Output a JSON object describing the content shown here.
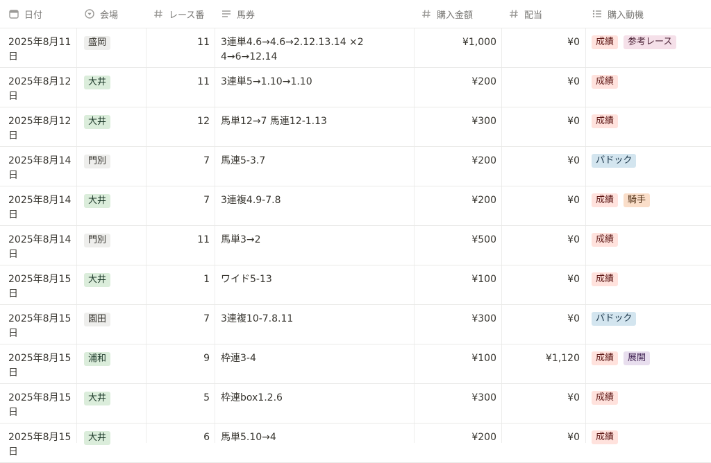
{
  "columns": [
    {
      "label": "日付",
      "icon": "calendar-icon"
    },
    {
      "label": "会場",
      "icon": "select-icon"
    },
    {
      "label": "レース番",
      "icon": "number-icon"
    },
    {
      "label": "馬券",
      "icon": "text-icon"
    },
    {
      "label": "購入金額",
      "icon": "number-icon"
    },
    {
      "label": "配当",
      "icon": "number-icon"
    },
    {
      "label": "購入動機",
      "icon": "list-icon"
    }
  ],
  "colors": {
    "venue": {
      "盛岡": {
        "bg": "#eeeeec",
        "fg": "#37352f"
      },
      "大井": {
        "bg": "#dbeddb",
        "fg": "#1c3829"
      },
      "門別": {
        "bg": "#eeeeec",
        "fg": "#37352f"
      },
      "園田": {
        "bg": "#eeeeec",
        "fg": "#37352f"
      },
      "浦和": {
        "bg": "#dbeddb",
        "fg": "#1c3829"
      }
    },
    "motive": {
      "成績": {
        "bg": "#ffe2dd",
        "fg": "#5d1715"
      },
      "参考レース": {
        "bg": "#f5e0e9",
        "fg": "#4c2337"
      },
      "パドック": {
        "bg": "#d3e5ef",
        "fg": "#183347"
      },
      "騎手": {
        "bg": "#fadec9",
        "fg": "#49290e"
      },
      "展開": {
        "bg": "#e8deee",
        "fg": "#412454"
      }
    }
  },
  "rows": [
    {
      "date": "2025年8月11日",
      "venue": "盛岡",
      "race": "11",
      "ticket": "3連単4.6→4.6→2.12.13.14 ×2 4→6→12.14",
      "amount": "¥1,000",
      "payout": "¥0",
      "motives": [
        "成績",
        "参考レース"
      ]
    },
    {
      "date": "2025年8月12日",
      "venue": "大井",
      "race": "11",
      "ticket": "3連単5→1.10→1.10",
      "amount": "¥200",
      "payout": "¥0",
      "motives": [
        "成績"
      ]
    },
    {
      "date": "2025年8月12日",
      "venue": "大井",
      "race": "12",
      "ticket": "馬単12→7 馬連12-1.13",
      "amount": "¥300",
      "payout": "¥0",
      "motives": [
        "成績"
      ]
    },
    {
      "date": "2025年8月14日",
      "venue": "門別",
      "race": "7",
      "ticket": "馬連5-3.7",
      "amount": "¥200",
      "payout": "¥0",
      "motives": [
        "パドック"
      ]
    },
    {
      "date": "2025年8月14日",
      "venue": "大井",
      "race": "7",
      "ticket": "3連複4.9-7.8",
      "amount": "¥200",
      "payout": "¥0",
      "motives": [
        "成績",
        "騎手"
      ]
    },
    {
      "date": "2025年8月14日",
      "venue": "門別",
      "race": "11",
      "ticket": "馬単3→2",
      "amount": "¥500",
      "payout": "¥0",
      "motives": [
        "成績"
      ]
    },
    {
      "date": "2025年8月15日",
      "venue": "大井",
      "race": "1",
      "ticket": "ワイド5-13",
      "amount": "¥100",
      "payout": "¥0",
      "motives": [
        "成績"
      ]
    },
    {
      "date": "2025年8月15日",
      "venue": "園田",
      "race": "7",
      "ticket": "3連複10-7.8.11",
      "amount": "¥300",
      "payout": "¥0",
      "motives": [
        "パドック"
      ]
    },
    {
      "date": "2025年8月15日",
      "venue": "浦和",
      "race": "9",
      "ticket": "枠連3-4",
      "amount": "¥100",
      "payout": "¥1,120",
      "motives": [
        "成績",
        "展開"
      ]
    },
    {
      "date": "2025年8月15日",
      "venue": "大井",
      "race": "5",
      "ticket": "枠連box1.2.6",
      "amount": "¥300",
      "payout": "¥0",
      "motives": [
        "成績"
      ]
    },
    {
      "date": "2025年8月15日",
      "venue": "大井",
      "race": "6",
      "ticket": "馬単5.10→4",
      "amount": "¥200",
      "payout": "¥0",
      "motives": [
        "成績"
      ]
    }
  ]
}
